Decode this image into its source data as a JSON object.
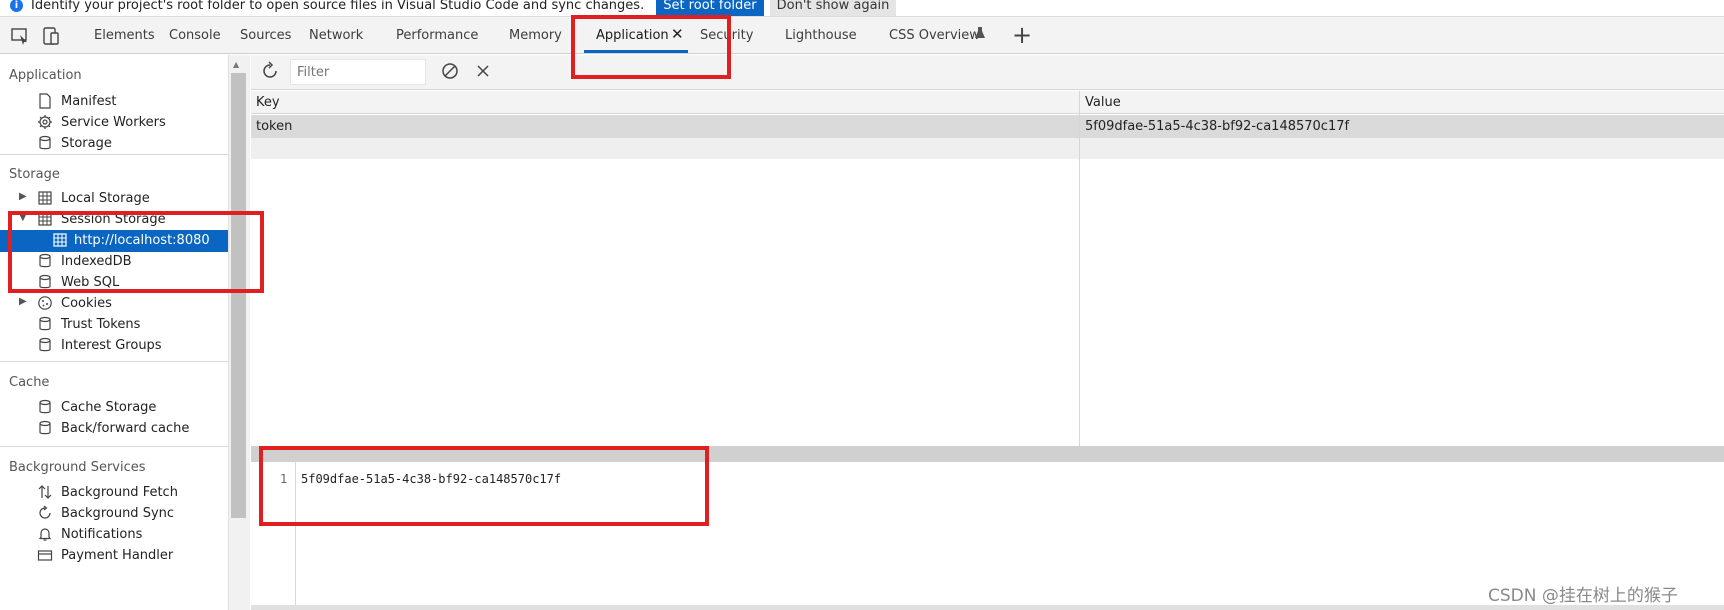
{
  "infobar": {
    "message": "Identify your project's root folder to open source files in Visual Studio Code and sync changes.",
    "primary_button": "Set root folder",
    "secondary_button": "Don't show again"
  },
  "tabs": [
    {
      "label": "Elements"
    },
    {
      "label": "Console"
    },
    {
      "label": "Sources"
    },
    {
      "label": "Network"
    },
    {
      "label": "Performance"
    },
    {
      "label": "Memory"
    },
    {
      "label": "Application",
      "active": true
    },
    {
      "label": "Security"
    },
    {
      "label": "Lighthouse"
    },
    {
      "label": "CSS Overview"
    }
  ],
  "sidebar": {
    "sections": {
      "application": "Application",
      "storage": "Storage",
      "cache": "Cache",
      "background": "Background Services"
    },
    "application_items": [
      "Manifest",
      "Service Workers",
      "Storage"
    ],
    "storage_items": {
      "local_storage": "Local Storage",
      "session_storage": "Session Storage",
      "session_child": "http://localhost:8080",
      "indexeddb": "IndexedDB",
      "websql": "Web SQL",
      "cookies": "Cookies",
      "trust_tokens": "Trust Tokens",
      "interest_groups": "Interest Groups"
    },
    "cache_items": [
      "Cache Storage",
      "Back/forward cache"
    ],
    "background_items": [
      "Background Fetch",
      "Background Sync",
      "Notifications",
      "Payment Handler"
    ]
  },
  "toolbar": {
    "filter_placeholder": "Filter"
  },
  "grid": {
    "columns": [
      "Key",
      "Value"
    ],
    "rows": [
      {
        "key": "token",
        "value": "5f09dfae-51a5-4c38-bf92-ca148570c17f"
      }
    ]
  },
  "preview": {
    "line_number": "1",
    "content": "5f09dfae-51a5-4c38-bf92-ca148570c17f"
  },
  "watermark": "CSDN @挂在树上的猴子",
  "colors": {
    "accent": "#0a66c2",
    "annotation": "#e02020"
  }
}
